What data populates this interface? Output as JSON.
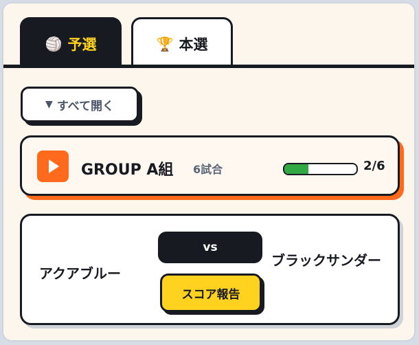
{
  "tabs": [
    {
      "label": "予選",
      "icon": "volleyball-icon",
      "glyph": "🏐",
      "active": true
    },
    {
      "label": "本選",
      "icon": "trophy-icon",
      "glyph": "🏆",
      "active": false
    }
  ],
  "toolbar": {
    "expand_all_label": "すべて開く",
    "expand_glyph": "▼"
  },
  "group": {
    "name": "GROUP A組",
    "match_count": "6試合",
    "progress_fraction": 0.333,
    "progress_text": "2/6"
  },
  "match": {
    "team_a": "アクアブルー",
    "vs_label": "vs",
    "team_b": "ブラックサンダー",
    "score_button_label": "スコア報告"
  },
  "colors": {
    "dark": "#181a22",
    "accent_orange": "#ff6a1c",
    "accent_yellow": "#ffd21f",
    "progress_green": "#32a845",
    "background": "#fdf6ec"
  }
}
